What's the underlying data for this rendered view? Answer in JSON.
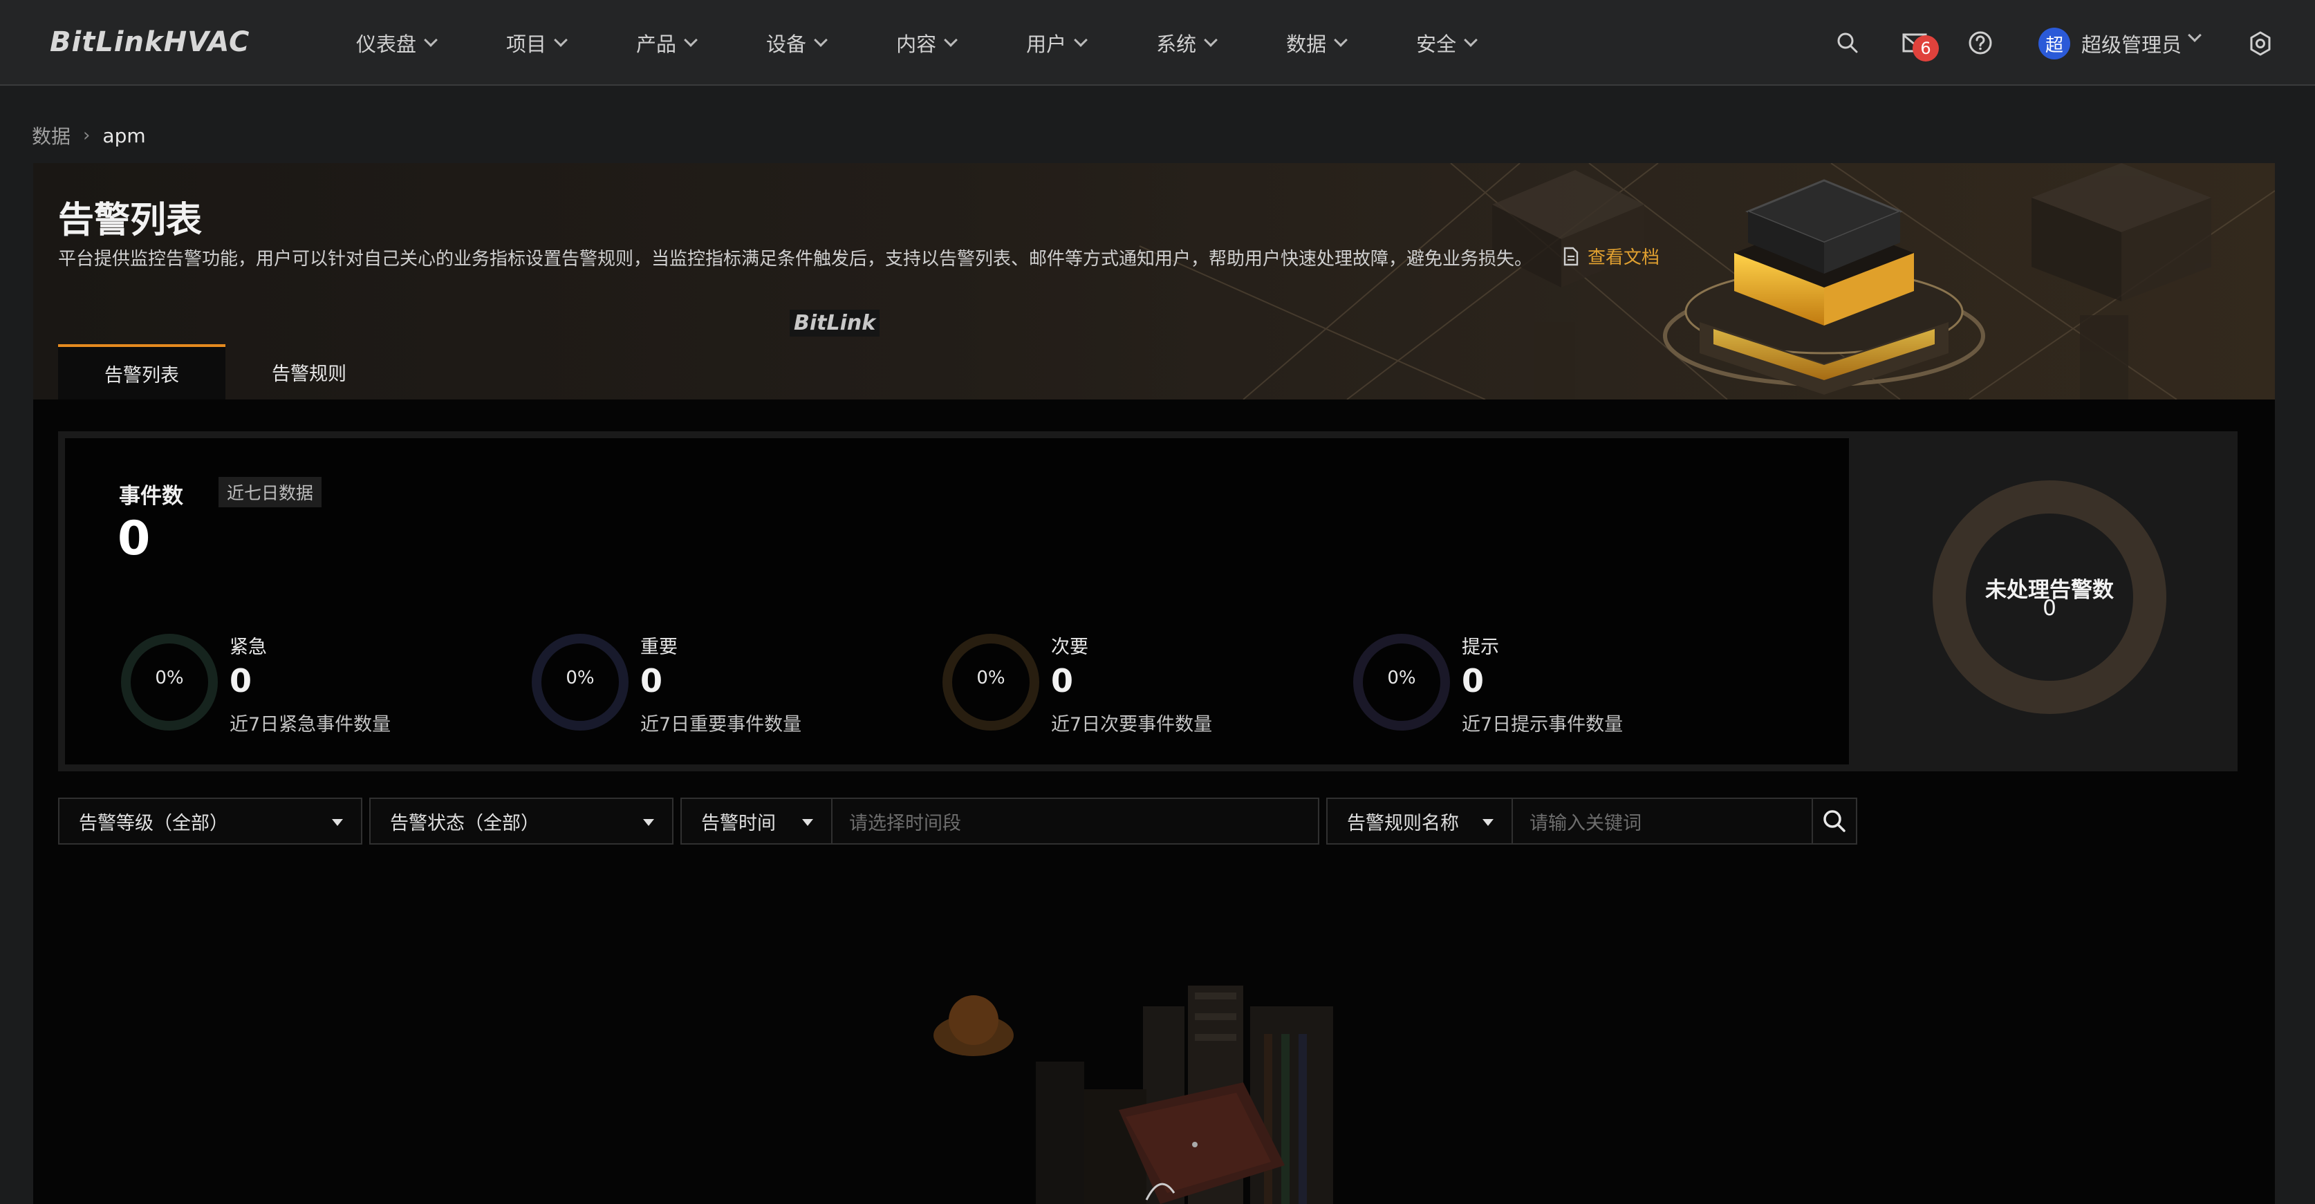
{
  "app": {
    "logo": "BitLinkHVAC"
  },
  "nav": {
    "menu": [
      "仪表盘",
      "项目",
      "产品",
      "设备",
      "内容",
      "用户",
      "系统",
      "数据",
      "安全"
    ],
    "message_count": "6",
    "avatar_char": "超",
    "username": "超级管理员",
    "icons": [
      "search-icon",
      "mail-icon",
      "help-icon",
      "user-avatar",
      "settings-icon"
    ]
  },
  "breadcrumb": {
    "items": [
      "数据",
      "apm"
    ]
  },
  "banner": {
    "title": "告警列表",
    "description": "平台提供监控告警功能，用户可以针对自己关心的业务指标设置告警规则，当监控指标满足条件触发后，支持以告警列表、邮件等方式通知用户，帮助用户快速处理故障，避免业务损失。",
    "doc_link": "查看文档",
    "brand_mark": "BitLink",
    "tabs": [
      {
        "label": "告警列表",
        "active": true
      },
      {
        "label": "告警规则",
        "active": false
      }
    ]
  },
  "stats": {
    "title": "事件数",
    "period_tag": "近七日数据",
    "total": "0",
    "severities": [
      {
        "name": "紧急",
        "percent": "0%",
        "count": "0",
        "desc": "近7日紧急事件数量",
        "color": "#16241e"
      },
      {
        "name": "重要",
        "percent": "0%",
        "count": "0",
        "desc": "近7日重要事件数量",
        "color": "#181a2c"
      },
      {
        "name": "次要",
        "percent": "0%",
        "count": "0",
        "desc": "近7日次要事件数量",
        "color": "#281e10"
      },
      {
        "name": "提示",
        "percent": "0%",
        "count": "0",
        "desc": "近7日提示事件数量",
        "color": "#1a1828"
      }
    ],
    "unhandled": {
      "title": "未处理告警数",
      "value": "0",
      "ring_color": "#3a3128"
    }
  },
  "filters": {
    "level": "告警等级（全部）",
    "status": "告警状态（全部）",
    "time_label": "告警时间",
    "time_placeholder": "请选择时间段",
    "rule_label": "告警规则名称",
    "keyword_placeholder": "请输入关键词"
  },
  "colors": {
    "accent": "#e58a1f",
    "link": "#e0a030",
    "badge": "#e0423c"
  }
}
